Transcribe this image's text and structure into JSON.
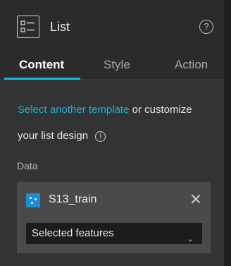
{
  "header": {
    "title": "List",
    "help": "?"
  },
  "tabs": [
    {
      "label": "Content",
      "active": true
    },
    {
      "label": "Style",
      "active": false
    },
    {
      "label": "Action",
      "active": false
    }
  ],
  "content": {
    "template_link": "Select another template",
    "template_text": "or customize your list design",
    "info_icon": "i",
    "data_label": "Data",
    "datasource": {
      "name": "S13_train",
      "select_value": "Selected features",
      "chevron": "⌄"
    }
  },
  "colors": {
    "accent": "#14b8d8",
    "link": "#1ab5d8",
    "datasource_icon": "#1f8dd6"
  }
}
